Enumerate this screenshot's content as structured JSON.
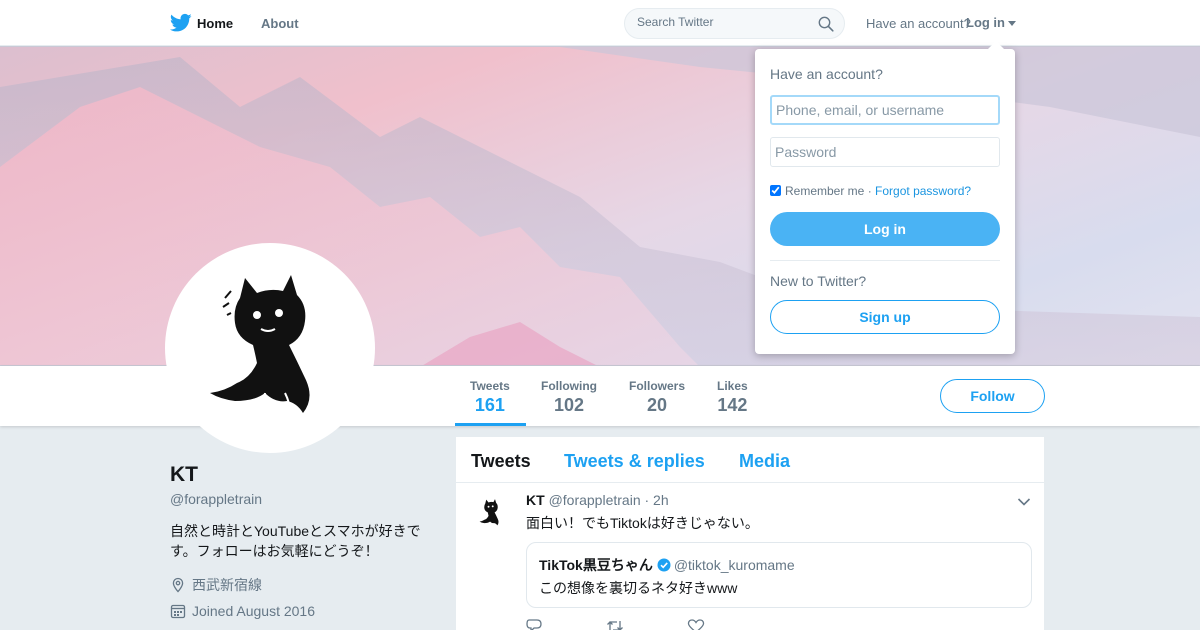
{
  "nav": {
    "home_label": "Home",
    "about_label": "About",
    "search_placeholder": "Search Twitter",
    "have_account": "Have an account?",
    "login_label": "Log in"
  },
  "profile": {
    "name": "KT",
    "handle": "@forappletrain",
    "bio": "自然と時計とYouTubeとスマホが好きです。フォローはお気軽にどうぞ！",
    "location": "西武新宿線",
    "joined": "Joined August 2016"
  },
  "stats": [
    {
      "label": "Tweets",
      "value": "161"
    },
    {
      "label": "Following",
      "value": "102"
    },
    {
      "label": "Followers",
      "value": "20"
    },
    {
      "label": "Likes",
      "value": "142"
    }
  ],
  "follow_label": "Follow",
  "tabs": [
    "Tweets",
    "Tweets & replies",
    "Media"
  ],
  "tweet": {
    "name": "KT",
    "handle": "@forappletrain",
    "time": "· 2h",
    "text": "面白い！でもTiktokは好きじゃない。",
    "quote": {
      "name": "TikTok黒豆ちゃん",
      "handle": "@tiktok_kuromame",
      "text": "この想像を裏切るネタ好きwww"
    }
  },
  "login_dropdown": {
    "title": "Have an account?",
    "username_placeholder": "Phone, email, or username",
    "password_placeholder": "Password",
    "remember_label": "Remember me",
    "separator": "·",
    "forgot_label": "Forgot password?",
    "login_button": "Log in",
    "new_label": "New to Twitter?",
    "signup_button": "Sign up"
  },
  "colors": {
    "accent": "#1da1f2",
    "login_button": "#4ab3f4",
    "verified": "#1da1f2"
  },
  "icons": [
    "twitter-bird-icon",
    "search-icon",
    "location-icon",
    "calendar-icon",
    "chevron-down-icon",
    "verified-icon",
    "reply-icon",
    "retweet-icon",
    "like-icon"
  ]
}
